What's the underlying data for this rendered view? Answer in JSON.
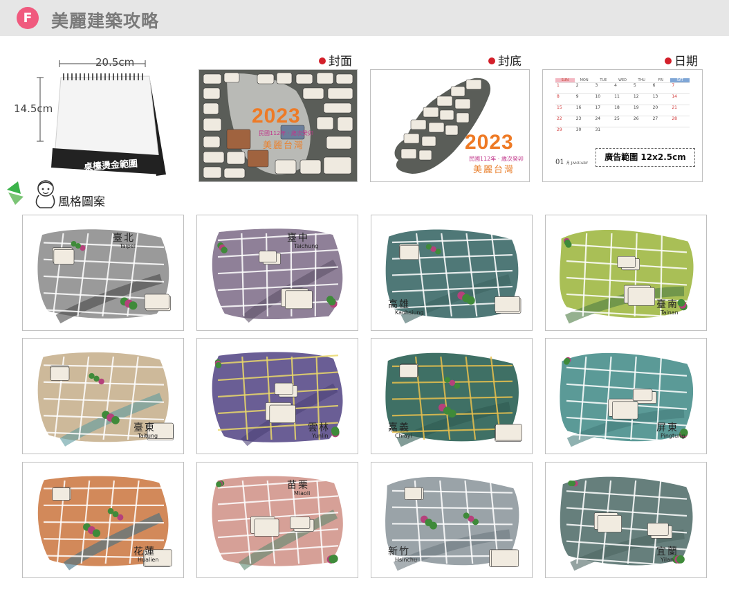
{
  "header": {
    "badge": "F",
    "title": "美麗建築攻略"
  },
  "desk_calendar": {
    "width_label": "20.5cm",
    "height_label": "14.5cm",
    "imprint_label": "桌檯燙金範圍"
  },
  "previews": {
    "cover": {
      "title": "封面",
      "year": "2023",
      "subtitle": "民國112年 · 歲次癸卯",
      "name": "美麗台灣"
    },
    "back": {
      "title": "封底",
      "year": "2023",
      "subtitle": "民國112年 · 歲次癸卯",
      "name": "美麗台灣"
    },
    "date": {
      "title": "日期",
      "weekdays": [
        "SUN",
        "MON",
        "TUE",
        "WED",
        "THU",
        "FRI",
        "SAT"
      ],
      "rows": [
        [
          "1",
          "2",
          "3",
          "4",
          "5",
          "6",
          "7"
        ],
        [
          "8",
          "9",
          "10",
          "11",
          "12",
          "13",
          "14"
        ],
        [
          "15",
          "16",
          "17",
          "18",
          "19",
          "20",
          "21"
        ],
        [
          "22",
          "23",
          "24",
          "25",
          "26",
          "27",
          "28"
        ],
        [
          "29",
          "30",
          "31",
          "",
          "",
          "",
          ""
        ]
      ],
      "ad_label": "廣告範圍 12x2.5cm",
      "month_num": "01",
      "month_name": "月 JANUARY"
    }
  },
  "style_section": {
    "title": "風格圖案"
  },
  "cities": [
    {
      "zh": "臺北",
      "en": "Taipei",
      "map": "#9a9a9a",
      "bg": "#4a4a4a",
      "road": "#ffffff"
    },
    {
      "zh": "臺中",
      "en": "Taichung",
      "map": "#8f8098",
      "bg": "#5e5168",
      "road": "#ffffff"
    },
    {
      "zh": "高雄",
      "en": "Kaohsiung",
      "map": "#4f7877",
      "bg": "#3e6463",
      "road": "#ffffff"
    },
    {
      "zh": "臺南",
      "en": "Tainan",
      "map": "#a9bf56",
      "bg": "#4f7d45",
      "road": "#ffffff"
    },
    {
      "zh": "臺東",
      "en": "Taitung",
      "map": "#cdb99a",
      "bg": "#5e9ba0",
      "road": "#ffffff"
    },
    {
      "zh": "雲林",
      "en": "Yunlin",
      "map": "#6a5e95",
      "bg": "#4c4378",
      "road": "#e9d86a"
    },
    {
      "zh": "嘉義",
      "en": "Chiayi",
      "map": "#3f7065",
      "bg": "#2e5a52",
      "road": "#e8c04e"
    },
    {
      "zh": "屏東",
      "en": "Pingtung",
      "map": "#5b9a97",
      "bg": "#447d7b",
      "road": "#ffffff"
    },
    {
      "zh": "花蓮",
      "en": "Hualien",
      "map": "#d2895a",
      "bg": "#3f6f86",
      "road": "#ffffff"
    },
    {
      "zh": "苗栗",
      "en": "Miaoli",
      "map": "#d6a097",
      "bg": "#5b8a72",
      "road": "#ffffff"
    },
    {
      "zh": "新竹",
      "en": "Hsinchu",
      "map": "#9aa3a8",
      "bg": "#6e7a80",
      "road": "#ffffff"
    },
    {
      "zh": "宜蘭",
      "en": "Yilan",
      "map": "#667f7c",
      "bg": "#4d6663",
      "road": "#ffffff"
    }
  ]
}
